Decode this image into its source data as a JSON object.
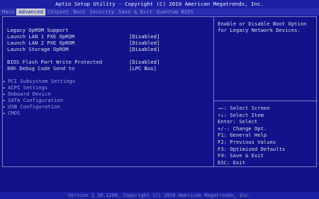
{
  "title": "Aptio Setup Utility - Copyright (C) 2010 American Megatrends, Inc.",
  "tabs": [
    "Main",
    "Advanced",
    "Chipset",
    "Boot",
    "Security",
    "Save & Exit",
    "Quantum BIOS"
  ],
  "section_heading": "Legacy OpROM Support",
  "settings": [
    {
      "label": "Launch LAN 1 PXE OpROM",
      "value": "[Disabled]"
    },
    {
      "label": "Launch LAN 2 PXE OpROM",
      "value": "[Disabled]"
    },
    {
      "label": "Launch Storage OpROM",
      "value": "[Disabled]"
    },
    {
      "label": "BIOS Flash Part Write Protected",
      "value": "[Disabled]"
    },
    {
      "label": "80h Debug Code Send to",
      "value": "[LPC Bus]"
    }
  ],
  "submenus": [
    "PCI Subsystem Settings",
    "ACPI Settings",
    "Onboard Device",
    "SATA Configuration",
    "USB Configuration",
    "CMOS"
  ],
  "help_text": "Enable or Disable Boot Option for Legacy Network Devices.",
  "key_help": [
    "→←: Select Screen",
    "↑↓: Select Item",
    "Enter: Select",
    "+/-: Change Opt.",
    "F1: General Help",
    "F2: Previous Values",
    "F3: Optimized Defaults",
    "F4: Save & Exit",
    "ESC: Exit"
  ],
  "footer": "Version 2.10.1208. Copyright (C) 2010 American Megatrends, Inc.",
  "colors": {
    "background": "#12128a",
    "active_tab": "#c9cbd8",
    "border": "#7b7ec9"
  }
}
